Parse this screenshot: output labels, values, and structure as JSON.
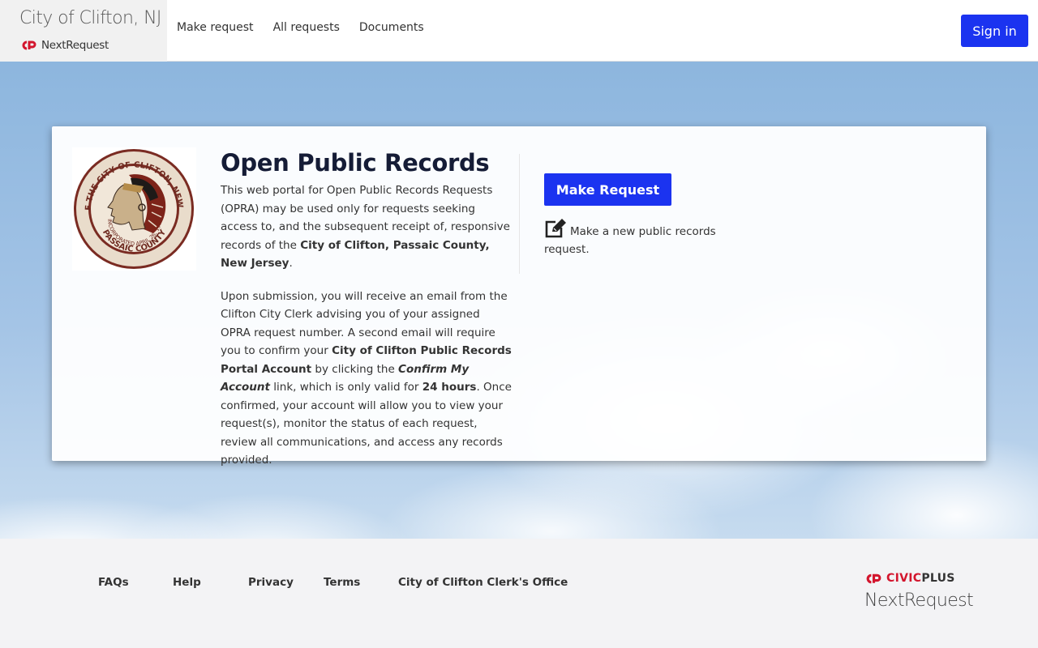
{
  "header": {
    "site_title": "City of Clifton, NJ",
    "product_name": "NextRequest",
    "nav": [
      "Make request",
      "All requests",
      "Documents"
    ],
    "sign_in_label": "Sign in"
  },
  "hero": {
    "title": "Open Public Records",
    "para1": [
      {
        "text": "This web portal for Open Public Records Requests (OPRA) may be used only for requests seeking access to, and the subsequent receipt of, responsive records of the ",
        "style": "normal"
      },
      {
        "text": "City of Clifton, Passaic County, New Jersey",
        "style": "bold"
      },
      {
        "text": ".",
        "style": "normal"
      }
    ],
    "para2": [
      {
        "text": "Upon submission, you will receive an email from the Clifton City Clerk advising you of your assigned OPRA request number. A second email will require you to confirm your ",
        "style": "normal"
      },
      {
        "text": "City of Clifton Public Records Portal Account",
        "style": "bold"
      },
      {
        "text": " by clicking the ",
        "style": "normal"
      },
      {
        "text": "Confirm My Account",
        "style": "bolditalic"
      },
      {
        "text": " link, which is only valid for ",
        "style": "normal"
      },
      {
        "text": "24 hours",
        "style": "bold"
      },
      {
        "text": ". Once confirmed, your account will allow you to view your request(s), monitor the status of each request, review all communications, and access any records provided.",
        "style": "normal"
      }
    ],
    "make_request_label": "Make Request",
    "make_request_desc": "Make a new public records request."
  },
  "seal": {
    "outer_text": "SEAL OF THE CITY OF CLIFTON, NEW JERSEY",
    "incorporated": "INCORPORATED APRIL 26, 1917",
    "county": "PASSAIC COUNTY"
  },
  "footer": {
    "links": [
      "FAQs",
      "Help",
      "Privacy",
      "Terms",
      "City of Clifton Clerk's Office"
    ],
    "civic_label": "CIVIC",
    "plus_label": "PLUS",
    "product_name": "NextRequest"
  },
  "colors": {
    "primary_button": "#1b33f0",
    "brand_red": "#d3152d",
    "title_navy": "#151c36"
  }
}
